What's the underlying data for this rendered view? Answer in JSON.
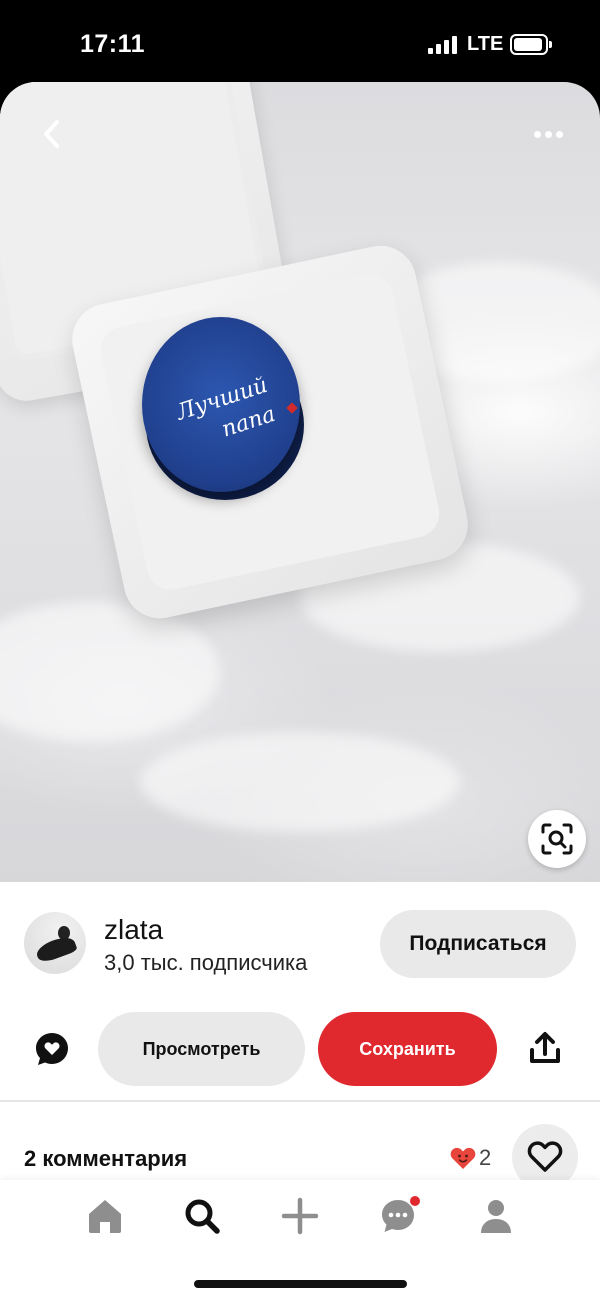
{
  "status_bar": {
    "time": "17:11",
    "network": "LTE"
  },
  "pin": {
    "cake_text_line1": "Лучший",
    "cake_text_line2": "папа",
    "image_colors": {
      "cake": "#203f8c",
      "fabric": "#e3e3e5"
    }
  },
  "author": {
    "name": "zlata",
    "subscribers": "3,0 тыс. подписчика",
    "follow_label": "Подписаться"
  },
  "actions": {
    "view_label": "Просмотреть",
    "save_label": "Сохранить",
    "accent": "#e0282f"
  },
  "comments": {
    "title": "2 комментария",
    "reaction_count": "2"
  },
  "nav": {
    "items": [
      "home-icon",
      "search-icon",
      "plus-icon",
      "messages-icon",
      "profile-icon"
    ]
  }
}
